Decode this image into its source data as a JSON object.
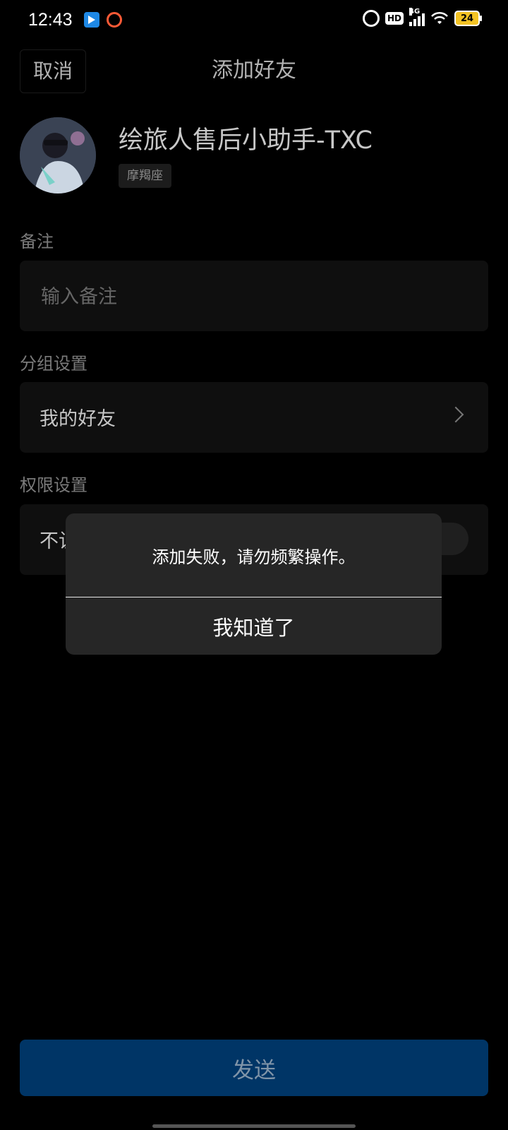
{
  "status_bar": {
    "time": "12:43",
    "network": "4G",
    "hd": "HD",
    "battery": "24",
    "icons": [
      "app-icon-blue",
      "ring-icon",
      "alarm-icon",
      "hd-icon",
      "signal-icon",
      "wifi-icon",
      "battery-icon"
    ]
  },
  "header": {
    "cancel_label": "取消",
    "title": "添加好友"
  },
  "profile": {
    "name": "绘旅人售后小助手-TXC",
    "tag": "摩羯座"
  },
  "remark": {
    "label": "备注",
    "placeholder": "输入备注",
    "value": ""
  },
  "group": {
    "label": "分组设置",
    "value": "我的好友"
  },
  "permission": {
    "label": "权限设置",
    "value_partial": "不让"
  },
  "dialog": {
    "message": "添加失败，请勿频繁操作。",
    "button": "我知道了"
  },
  "send_button": "发送",
  "colors": {
    "background": "#000000",
    "card": "#0f0f0f",
    "dialog": "#262626",
    "send_button": "#003566",
    "battery": "#f3c324",
    "ring": "#ff5a36"
  }
}
